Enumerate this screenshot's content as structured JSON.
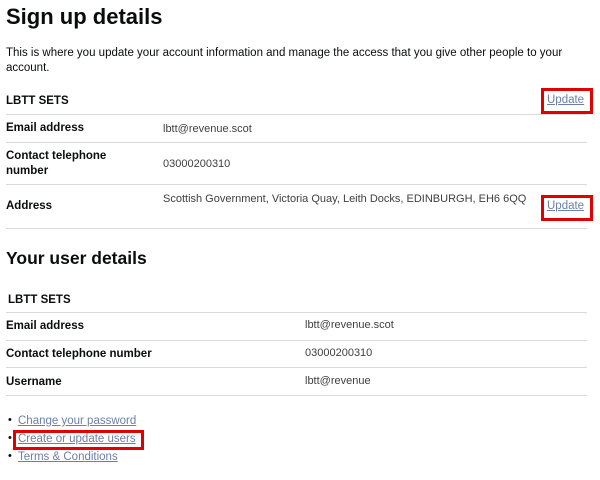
{
  "signup": {
    "title": "Sign up details",
    "intro": "This is where you update your account information and manage the access that you give other people to your account.",
    "section": "LBTT SETS",
    "update_label": "Update",
    "rows": [
      {
        "label": "Email address",
        "value": "lbtt@revenue.scot"
      },
      {
        "label": "Contact telephone number",
        "value": "03000200310"
      },
      {
        "label": "Address",
        "value": "Scottish Government, Victoria Quay, Leith Docks, EDINBURGH, EH6 6QQ"
      }
    ]
  },
  "user": {
    "title": "Your user details",
    "section": "LBTT SETS",
    "rows": [
      {
        "label": "Email address",
        "value": "lbtt@revenue.scot"
      },
      {
        "label": "Contact telephone number",
        "value": "03000200310"
      },
      {
        "label": "Username",
        "value": "lbtt@revenue"
      }
    ]
  },
  "links": [
    "Change your password",
    "Create or update users",
    "Terms & Conditions"
  ],
  "colors": {
    "highlight": "#e00000",
    "link": "#6b7fa8",
    "rule": "#d9d9d9"
  }
}
